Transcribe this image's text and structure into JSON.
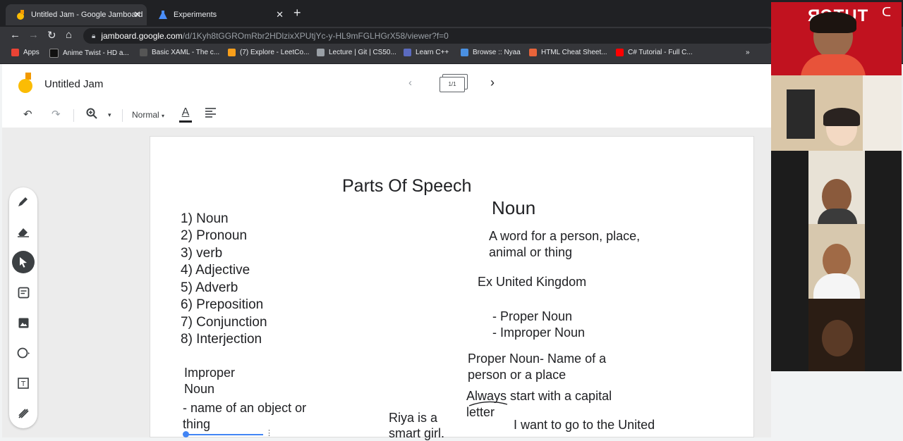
{
  "browser": {
    "tabs": [
      {
        "title": "Untitled Jam - Google Jamboard",
        "active": true
      },
      {
        "title": "Experiments",
        "active": false
      }
    ],
    "new_tab": "+",
    "tab_close": "✕",
    "url_host": "jamboard.google.com",
    "url_path": "/d/1Kyh8tGGROmRbr2HDlzixXPUtjYc-y-HL9mFGLHGrX58/viewer?f=0",
    "bookmarks": [
      {
        "label": "Apps",
        "color": "#ea4335"
      },
      {
        "label": "Anime Twist - HD a...",
        "color": "#202124"
      },
      {
        "label": "Basic XAML - The c...",
        "color": "#555555"
      },
      {
        "label": "(7) Explore - LeetCo...",
        "color": "#f89f1b"
      },
      {
        "label": "Lecture | Git | CS50...",
        "color": "#9aa0a6"
      },
      {
        "label": "Learn C++",
        "color": "#5b6bc0"
      },
      {
        "label": "Browse :: Nyaa",
        "color": "#4a90e2"
      },
      {
        "label": "HTML Cheat Sheet...",
        "color": "#e8643a"
      },
      {
        "label": "C# Tutorial - Full C...",
        "color": "#ff0000"
      }
    ],
    "more_bookmarks": "»"
  },
  "app": {
    "doc_title": "Untitled Jam",
    "frame_counter": "1/1",
    "text_style": "Normal",
    "text_color_glyph": "A"
  },
  "board": {
    "title": "Parts Of Speech",
    "parts_list": [
      "1) Noun",
      "2) Pronoun",
      "3) verb",
      "4) Adjective",
      "5) Adverb",
      "6) Preposition",
      "7) Conjunction",
      "8) Interjection"
    ],
    "improper_heading_1": "Improper",
    "improper_heading_2": "Noun",
    "improper_def_1": "- name of an object or",
    "improper_def_2": "thing",
    "noun_heading": "Noun",
    "noun_def_1": "A word for a person, place,",
    "noun_def_2": "animal or thing",
    "example": "Ex United Kingdom",
    "type_1": "- Proper Noun",
    "type_2": "- Improper Noun",
    "proper_def_1": "Proper Noun- Name of a",
    "proper_def_2": "person or a place",
    "rule_1": "Always start with a capital",
    "rule_2": "letter",
    "sentence_1a": "Riya is a",
    "sentence_1b": "smart girl.",
    "sentence_2": "I want to go to the United"
  },
  "video": {
    "logo_text": "ЯƆTUT",
    "tiles": [
      {
        "bg": "#c1121f"
      },
      {
        "bg": "#d9c6a8"
      },
      {
        "bg": "#e8e2d6"
      },
      {
        "bg": "#d7c8ae"
      },
      {
        "bg": "#2b1d14"
      }
    ]
  },
  "colors": {
    "accent": "#4285f4",
    "jamboard_yellow": "#fbbc04",
    "jamboard_orange": "#f29900"
  }
}
